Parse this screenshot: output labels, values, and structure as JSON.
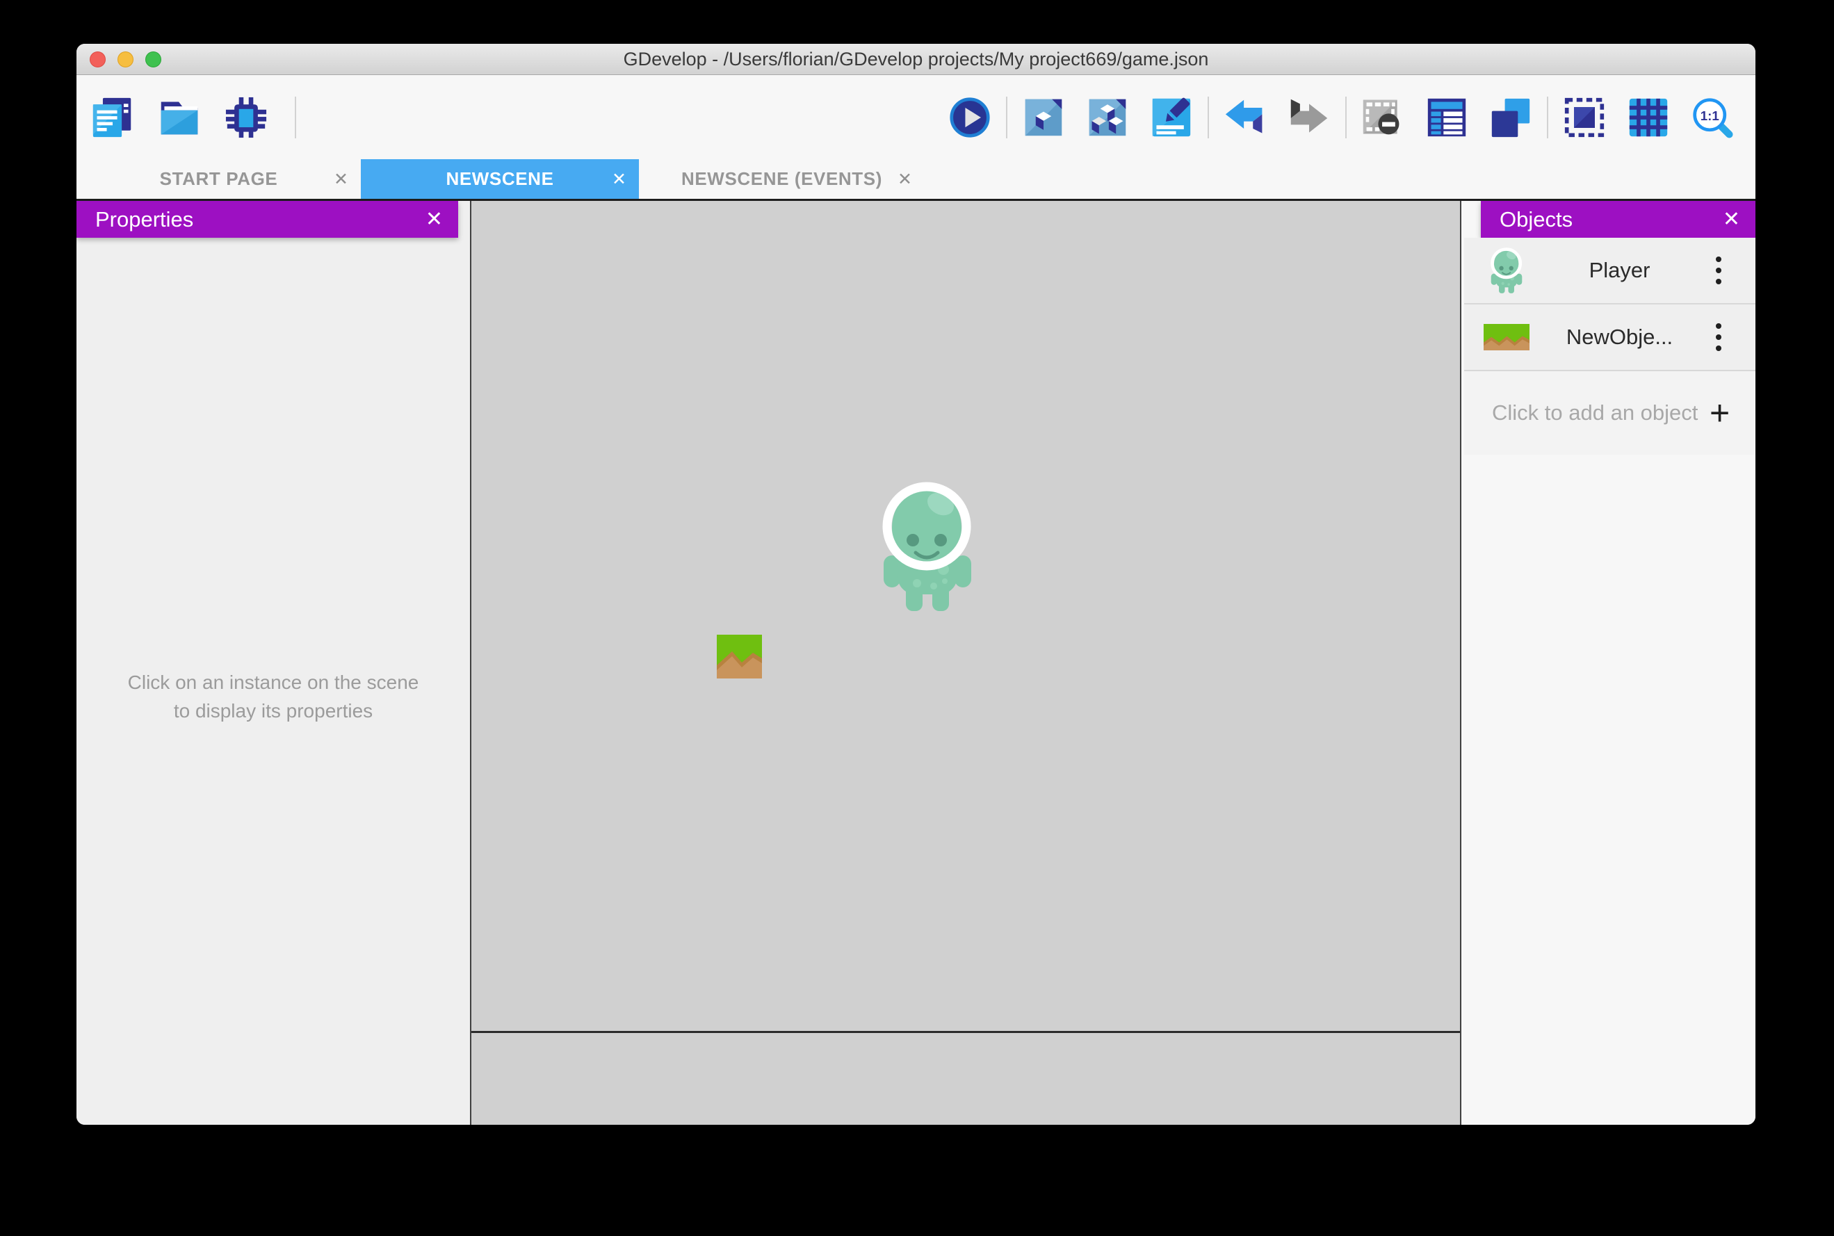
{
  "window": {
    "title": "GDevelop - /Users/florian/GDevelop projects/My project669/game.json"
  },
  "titlebar": {
    "buttons": [
      "close",
      "minimize",
      "fullscreen"
    ]
  },
  "toolbar": {
    "left_icons": [
      "new-file",
      "open-folder",
      "debugger"
    ],
    "right_icons": [
      "play",
      "add-object-document",
      "add-objects-document",
      "edit-scene-properties",
      "undo",
      "redo",
      "preview-disabled",
      "objects-list",
      "layers",
      "mask-frame",
      "grid",
      "zoom-1-1"
    ]
  },
  "tabs": [
    {
      "label": "START PAGE",
      "active": false
    },
    {
      "label": "NEWSCENE",
      "active": true
    },
    {
      "label": "NEWSCENE (EVENTS)",
      "active": false
    }
  ],
  "properties": {
    "title": "Properties",
    "empty_message": "Click on an instance on the scene to display its properties"
  },
  "objects": {
    "title": "Objects",
    "items": [
      {
        "name": "Player",
        "icon": "player-sprite"
      },
      {
        "name": "NewObje...",
        "icon": "terrain-tile"
      }
    ],
    "add_label": "Click to add an object"
  },
  "scene": {
    "instances": [
      {
        "object": "Player"
      },
      {
        "object": "NewObject"
      }
    ]
  },
  "ui": {
    "close_glyph": "✕",
    "plus_glyph": "+"
  },
  "colors": {
    "accent_purple": "#9d10c2",
    "active_tab_blue": "#47aaf2",
    "canvas_gray": "#d0d0d0",
    "icon_navy": "#2e3192",
    "icon_blue": "#29a7e8",
    "player_teal": "#7fc8a8",
    "tile_green": "#6fbf10",
    "tile_brown": "#c9945c"
  }
}
